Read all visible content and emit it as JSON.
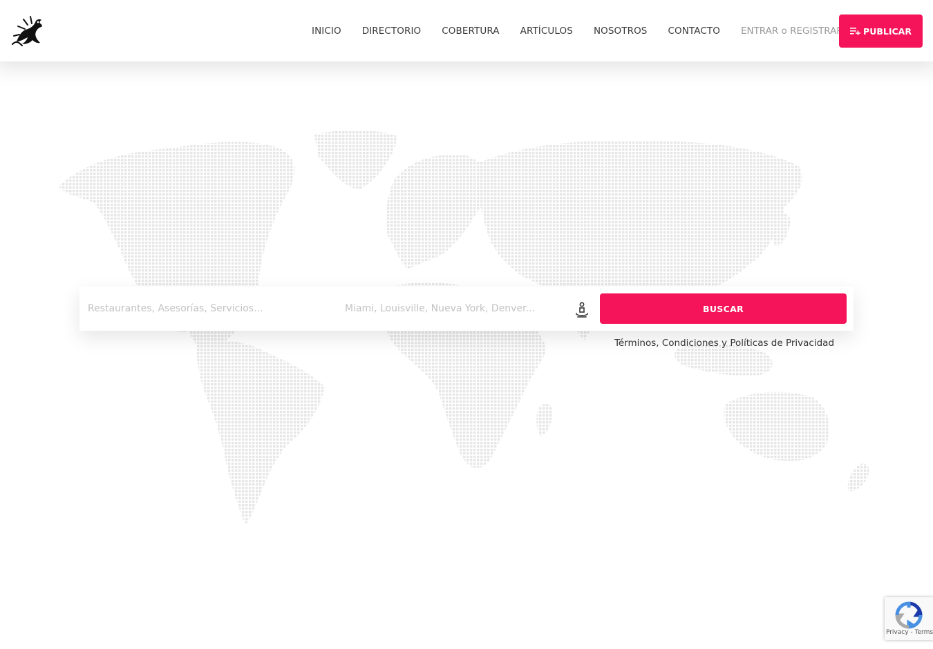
{
  "header": {
    "nav": {
      "inicio": "INICIO",
      "directorio": "DIRECTORIO",
      "cobertura": "COBERTURA",
      "articulos": "ARTÍCULOS",
      "nosotros": "NOSOTROS",
      "contacto": "CONTACTO"
    },
    "login": "ENTRAR o REGISTRARSE",
    "publish_label": "PUBLICAR"
  },
  "search": {
    "what_placeholder": "Restaurantes, Asesorías, Servicios...",
    "where_placeholder": "Miami, Louisville, Nueva York, Denver...",
    "button_label": "BUSCAR"
  },
  "terms_link": "Términos, Condiciones y Políticas de Privacidad",
  "recaptcha": {
    "privacy": "Privacy",
    "separator": " - ",
    "terms": "Terms"
  },
  "colors": {
    "accent": "#f5145a",
    "map_dots": "#e6e6e6"
  },
  "icons": {
    "logo": "horse-logo-icon",
    "publish": "playlist-add-icon",
    "locate": "person-pin-icon",
    "recaptcha": "recaptcha-icon"
  }
}
